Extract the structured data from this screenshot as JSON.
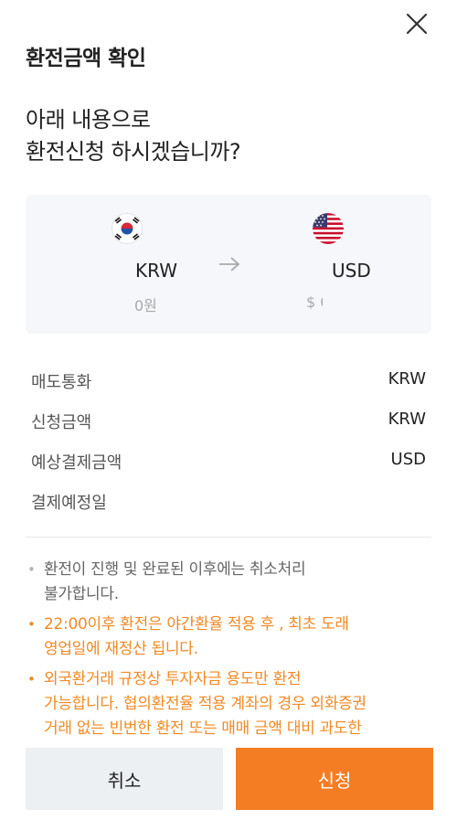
{
  "dialog": {
    "title": "환전금액 확인",
    "question_line1": "아래 내용으로",
    "question_line2": "환전신청 하시겠습니까?"
  },
  "exchange": {
    "from": {
      "code": "KRW",
      "amount": "0원",
      "flag_icon": "korea-flag-icon"
    },
    "to": {
      "code": "USD",
      "amount": "$ 0",
      "flag_icon": "usa-flag-icon"
    },
    "arrow_icon": "right-arrow-icon"
  },
  "details": [
    {
      "label": "매도통화",
      "value": "KRW"
    },
    {
      "label": "신청금액",
      "value": "KRW"
    },
    {
      "label": "예상결제금액",
      "value": "USD"
    },
    {
      "label": "결제예정일",
      "value": ""
    }
  ],
  "notices": [
    {
      "lines": [
        "환전이 진행 및 완료된 이후에는 취소처리",
        "불가합니다."
      ],
      "color": "#666666"
    },
    {
      "lines": [
        "22:00이후 환전은 야간환율 적용 후 , 최초 도래",
        "영업일에 재정산 됩니다."
      ],
      "color": "#f08a24"
    },
    {
      "lines": [
        "외국환거래 규정상 투자자금 용도만 환전",
        "가능합니다. 협의환전율 적용 계좌의 경우 외화증권",
        "거래 없는 빈번한 환전 또는 매매 금액 대비 과도한"
      ],
      "color": "#f08a24"
    }
  ],
  "buttons": {
    "cancel_label": "취소",
    "apply_label": "신청"
  },
  "colors": {
    "accent": "#f47d24",
    "notice_orange": "#f08a24",
    "card_bg": "#f5f7fa",
    "cancel_bg": "#edf0f3"
  }
}
